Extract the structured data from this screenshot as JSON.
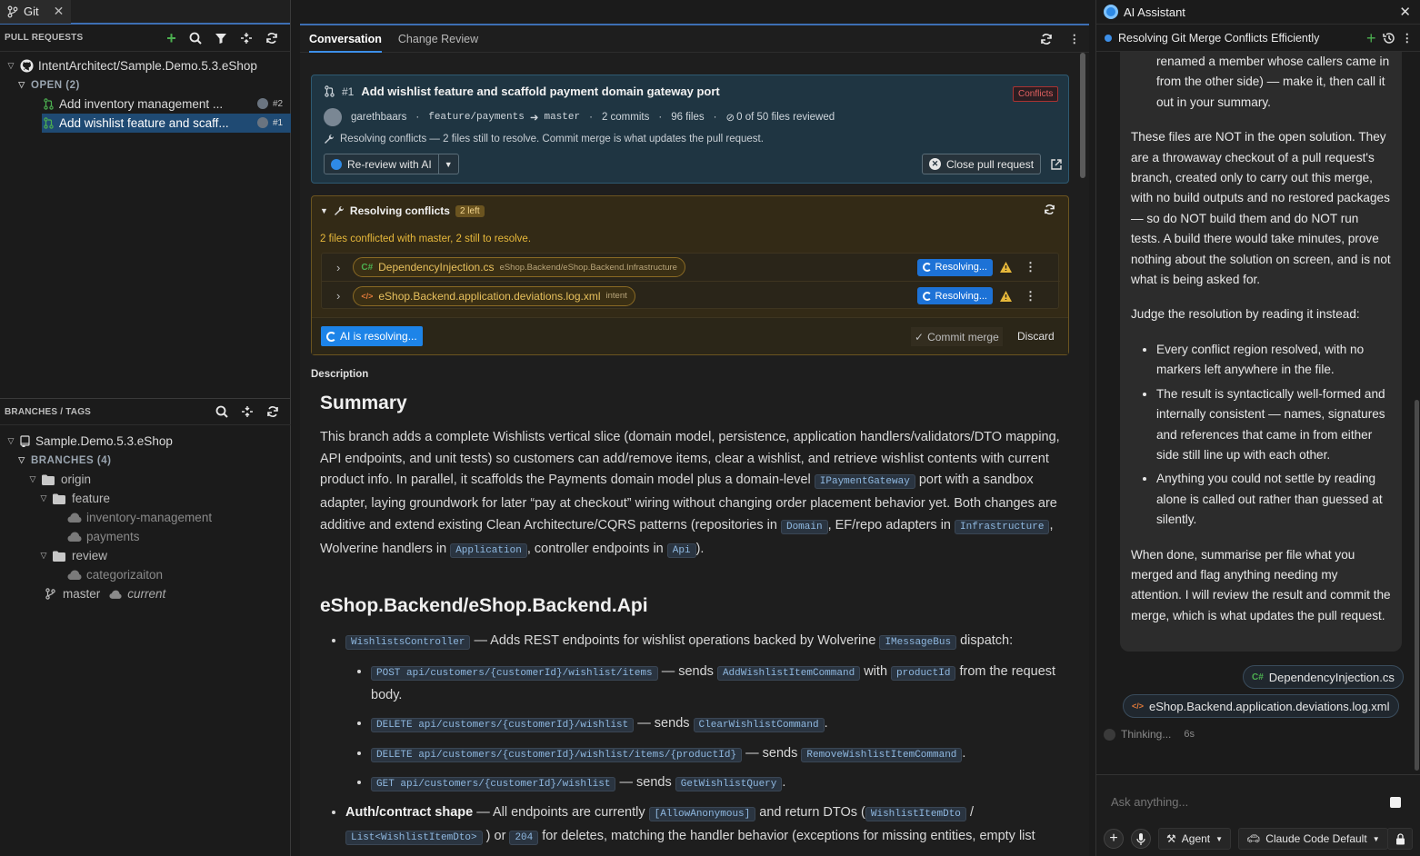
{
  "git_tab": {
    "title": "Git"
  },
  "pull_requests": {
    "header": "PULL REQUESTS",
    "repo": "IntentArchitect/Sample.Demo.5.3.eShop",
    "open_label": "OPEN (2)",
    "items": [
      {
        "title": "Add inventory management ...",
        "number": "#2"
      },
      {
        "title": "Add wishlist feature and scaff...",
        "number": "#1"
      }
    ]
  },
  "branches": {
    "header": "BRANCHES / TAGS",
    "repo": "Sample.Demo.5.3.eShop",
    "branches_label": "BRANCHES (4)",
    "origin": "origin",
    "feature": "feature",
    "inventory": "inventory-management",
    "payments": "payments",
    "review": "review",
    "categorizaiton": "categorizaiton",
    "master": "master",
    "current": "current"
  },
  "tabs": {
    "conversation": "Conversation",
    "change_review": "Change Review"
  },
  "pr": {
    "number": "#1",
    "title": "Add wishlist feature and scaffold payment domain gateway port",
    "status": "Conflicts",
    "author": "garethbaars",
    "source_branch": "feature/payments",
    "target_branch": "master",
    "commits": "2 commits",
    "files": "96 files",
    "reviewed": "0 of 50 files reviewed",
    "notice": "Resolving conflicts — 2 files still to resolve. Commit merge is what updates the pull request.",
    "rereview_label": "Re-review with AI",
    "close_label": "Close pull request"
  },
  "conflicts": {
    "title": "Resolving conflicts",
    "badge": "2 left",
    "summary": "2 files conflicted with master, 2 still to resolve.",
    "files": [
      {
        "lang": "C#",
        "name": "DependencyInjection.cs",
        "path": "eShop.Backend/eShop.Backend.Infrastructure",
        "status": "Resolving..."
      },
      {
        "lang": "</>",
        "name": "eShop.Backend.application.deviations.log.xml",
        "path": "intent",
        "status": "Resolving..."
      }
    ],
    "ai_button": "AI is resolving...",
    "commit_label": "Commit merge",
    "discard_label": "Discard"
  },
  "description": {
    "label": "Description",
    "h_summary": "Summary",
    "p1": "This branch adds a complete Wishlists vertical slice (domain model, persistence, application handlers/validators/DTO mapping, API endpoints, and unit tests) so customers can add/remove items, clear a wishlist, and retrieve wishlist contents with current product info. In parallel, it scaffolds the Payments domain model plus a domain-level",
    "code_gateway": "IPaymentGateway",
    "p2": "port with a sandbox adapter, laying groundwork for later “pay at checkout” wiring without changing order placement behavior yet. Both changes are additive and extend existing Clean Architecture/CQRS patterns (repositories in",
    "code_domain": "Domain",
    "p3": ", EF/repo adapters in",
    "code_infra": "Infrastructure",
    "p4": ", Wolverine handlers in",
    "code_app": "Application",
    "p5": ", controller endpoints in",
    "code_api": "Api",
    "p6": ").",
    "h_api": "eShop.Backend/eShop.Backend.Api",
    "b1_code": "WishlistsController",
    "b1_text": "— Adds REST endpoints for wishlist operations backed by Wolverine",
    "b1_code2": "IMessageBus",
    "b1_end": "dispatch:",
    "s1_code": "POST api/customers/{customerId}/wishlist/items",
    "s1_text": "— sends",
    "s1_code2": "AddWishlistItemCommand",
    "s1_with": "with",
    "s1_code3": "productId",
    "s1_end": "from the request body.",
    "s2_code": "DELETE api/customers/{customerId}/wishlist",
    "s2_text": "— sends",
    "s2_code2": "ClearWishlistCommand",
    "s2_end": ".",
    "s3_code": "DELETE api/customers/{customerId}/wishlist/items/{productId}",
    "s3_text": "— sends",
    "s3_code2": "RemoveWishlistItemCommand",
    "s3_end": ".",
    "s4_code": "GET api/customers/{customerId}/wishlist",
    "s4_text": "— sends",
    "s4_code2": "GetWishlistQuery",
    "s4_end": ".",
    "b2_bold": "Auth/contract shape",
    "b2_text": "— All endpoints are currently",
    "b2_code": "[AllowAnonymous]",
    "b2_text2": "and return DTOs (",
    "b2_code2": "WishlistItemDto",
    "b2_slash": "/",
    "b2_code3": "List<WishlistItemDto>",
    "b2_text3": ") or",
    "b2_code4": "204",
    "b2_text4": "for deletes, matching the handler behavior (exceptions for missing entities, empty list"
  },
  "assistant": {
    "title": "AI Assistant",
    "session": "Resolving Git Merge Conflicts Efficiently",
    "m0": "renamed a member whose callers came in from the other side) — make it, then call it out in your summary.",
    "m1": "These files are NOT in the open solution. They are a throwaway checkout of a pull request's branch, created only to carry out this merge, with no build outputs and no restored packages — so do NOT build them and do NOT run tests. A build there would take minutes, prove nothing about the solution on screen, and is not what is being asked for.",
    "m2": "Judge the resolution by reading it instead:",
    "bullets": [
      "Every conflict region resolved, with no markers left anywhere in the file.",
      "The result is syntactically well-formed and internally consistent — names, signatures and references that came in from either side still line up with each other.",
      "Anything you could not settle by reading alone is called out rather than guessed at silently."
    ],
    "m3": "When done, summarise per file what you merged and flag anything needing my attention. I will review the result and commit the merge, which is what updates the pull request.",
    "chip1": "DependencyInjection.cs",
    "chip2": "eShop.Backend.application.deviations.log.xml",
    "thinking": "Thinking...",
    "thinking_time": "6s",
    "input_placeholder": "Ask anything...",
    "agent_label": "Agent",
    "model_label": "Claude Code Default"
  },
  "colors": {
    "accent": "#3d8fe8",
    "conflict": "#e06060",
    "warning": "#e7b83a",
    "success": "#4caf50"
  }
}
